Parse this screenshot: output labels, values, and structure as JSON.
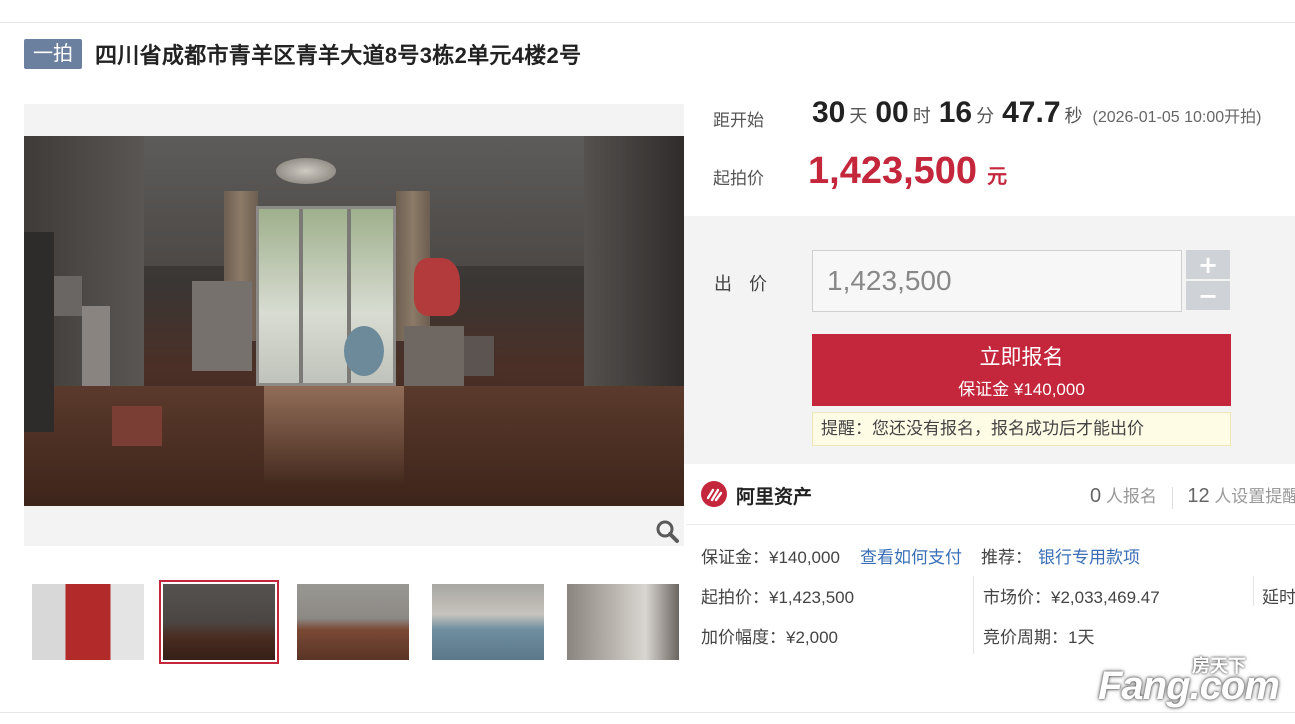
{
  "title": {
    "badge": "一拍",
    "address": "四川省成都市青羊区青羊大道8号3栋2单元4楼2号"
  },
  "countdown": {
    "label": "距开始",
    "days": "30",
    "days_unit": "天",
    "hours": "00",
    "hours_unit": "时",
    "minutes": "16",
    "minutes_unit": "分",
    "seconds": "47.7",
    "seconds_unit": "秒",
    "start_note": "(2026-01-05 10:00开拍)"
  },
  "start_price": {
    "label": "起拍价",
    "value": "1,423,500",
    "unit": "元"
  },
  "bid": {
    "label": "出 价",
    "input_value": "1,423,500",
    "plus": "+",
    "minus": "−",
    "register_label": "立即报名",
    "deposit_label": "保证金 ¥140,000",
    "reminder": "提醒：您还没有报名，报名成功后才能出价"
  },
  "ali": {
    "name": "阿里资产",
    "signup_count": "0",
    "signup_label": "人报名",
    "reminder_count": "12",
    "reminder_label": "人设置提醒"
  },
  "details": {
    "deposit": "保证金：¥140,000",
    "how_to_pay": "查看如何支付",
    "recommend_label": "推荐：",
    "bank_loan": "银行专用款项",
    "start_price": "起拍价：¥1,423,500",
    "market_price": "市场价：¥2,033,469.47",
    "delay": "延时",
    "increment": "加价幅度：¥2,000",
    "cycle": "竞价周期：1天"
  },
  "watermark": {
    "cn": "房天下",
    "en": "Fang.com"
  },
  "colors": {
    "accent_red": "#c4273c",
    "badge_blue": "#6b7f9e",
    "link_blue": "#3a6fb6"
  },
  "icons": [
    "zoom-icon",
    "ali-asset-logo",
    "plus-icon",
    "minus-icon"
  ]
}
